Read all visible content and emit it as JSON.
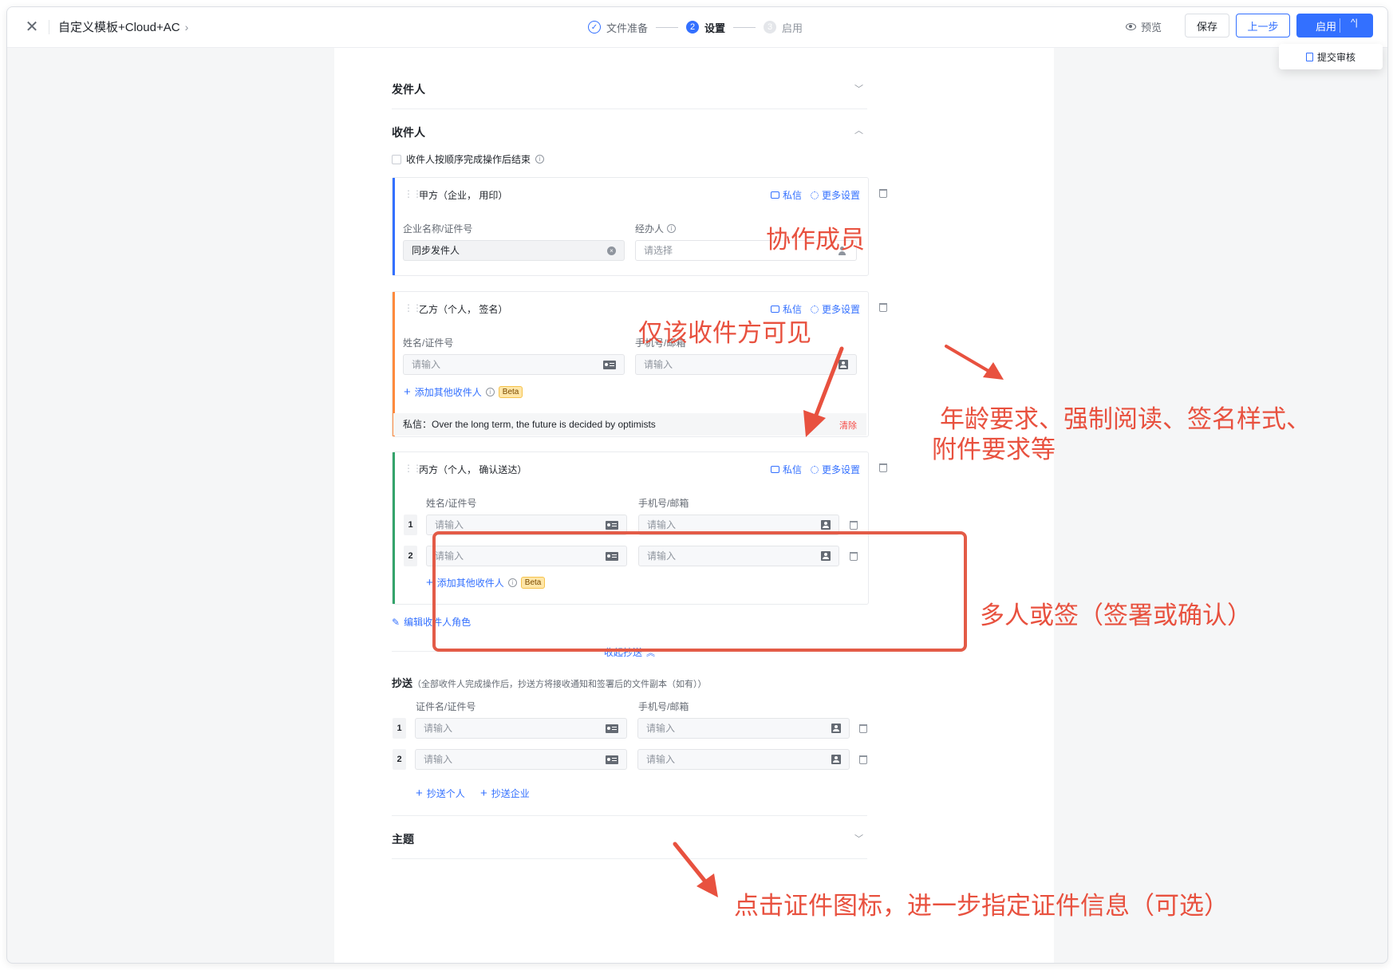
{
  "topbar": {
    "title": "自定义模板+Cloud+AC",
    "steps": [
      {
        "label": "文件准备",
        "state": "done",
        "marker": "✓"
      },
      {
        "label": "设置",
        "state": "active",
        "marker": "2"
      },
      {
        "label": "启用",
        "state": "wait",
        "marker": "3"
      }
    ],
    "preview_label": "预览",
    "save_label": "保存",
    "prev_label": "上一步",
    "enable_label": "启用",
    "dropdown_item": "提交审核"
  },
  "sender_section": {
    "title": "发件人"
  },
  "recipient_section": {
    "title": "收件人",
    "sequential_checkbox_label": "收件人按顺序完成操作后结束"
  },
  "party_a": {
    "title": "甲方（企业， 用印）",
    "message_link": "私信",
    "more_settings_link": "更多设置",
    "company_label": "企业名称/证件号",
    "company_value": "同步发件人",
    "handler_label": "经办人",
    "handler_placeholder": "请选择",
    "bar_color": "#3370ff"
  },
  "party_b": {
    "title": "乙方（个人， 签名）",
    "message_link": "私信",
    "more_settings_link": "更多设置",
    "name_label": "姓名/证件号",
    "phone_label": "手机号/邮箱",
    "name_placeholder": "请输入",
    "phone_placeholder": "请输入",
    "add_recipient": "添加其他收件人",
    "beta": "Beta",
    "note": "私信：Over the long term, the future is decided by optimists",
    "note_clear": "清除",
    "bar_color": "#ff8a3d"
  },
  "party_c": {
    "title": "丙方（个人， 确认送达）",
    "message_link": "私信",
    "more_settings_link": "更多设置",
    "name_label": "姓名/证件号",
    "phone_label": "手机号/邮箱",
    "rows": [
      {
        "num": "1",
        "name_placeholder": "请输入",
        "phone_placeholder": "请输入"
      },
      {
        "num": "2",
        "name_placeholder": "请输入",
        "phone_placeholder": "请输入"
      }
    ],
    "add_recipient": "添加其他收件人",
    "beta": "Beta",
    "bar_color": "#34a46b"
  },
  "edit_roles_link": "编辑收件人角色",
  "collapse_cc_link": "收起抄送",
  "cc_section": {
    "title": "抄送",
    "hint": "（全部收件人完成操作后，抄送方将接收通知和签署后的文件副本（如有））",
    "name_label": "证件名/证件号",
    "phone_label": "手机号/邮箱",
    "rows": [
      {
        "num": "1",
        "name_placeholder": "请输入",
        "phone_placeholder": "请输入"
      },
      {
        "num": "2",
        "name_placeholder": "请输入",
        "phone_placeholder": "请输入"
      }
    ],
    "add_person": "抄送个人",
    "add_company": "抄送企业"
  },
  "subject_section": {
    "title": "主题"
  },
  "annotations": {
    "collaborator": "协作成员",
    "only_visible": "仅该收件方可见",
    "requirements_line1": "年龄要求、强制阅读、签名样式、",
    "requirements_line2": "附件要求等",
    "multi_sign": "多人或签（签署或确认）",
    "id_icon_hint": "点击证件图标，进一步指定证件信息（可选）",
    "color": "#e8513f"
  }
}
